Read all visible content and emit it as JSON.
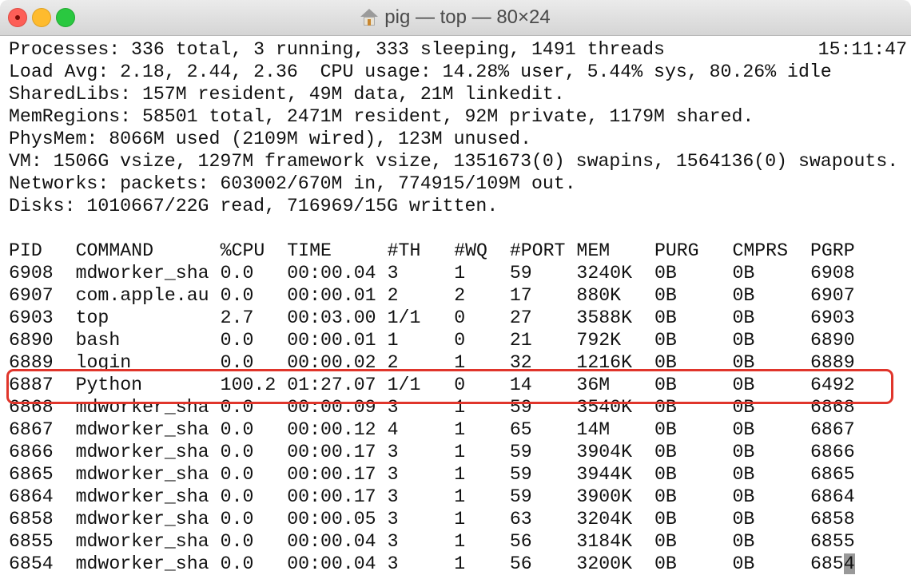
{
  "window": {
    "title": "pig — top — 80×24",
    "title_icon": "home-icon"
  },
  "summary": {
    "lines": [
      "Processes: 336 total, 3 running, 333 sleeping, 1491 threads",
      "Load Avg: 2.18, 2.44, 2.36  CPU usage: 14.28% user, 5.44% sys, 80.26% idle",
      "SharedLibs: 157M resident, 49M data, 21M linkedit.",
      "MemRegions: 58501 total, 2471M resident, 92M private, 1179M shared.",
      "PhysMem: 8066M used (2109M wired), 123M unused.",
      "VM: 1506G vsize, 1297M framework vsize, 1351673(0) swapins, 1564136(0) swapouts.",
      "Networks: packets: 603002/670M in, 774915/109M out.",
      "Disks: 1010667/22G read, 716969/15G written."
    ],
    "clock": "15:11:47"
  },
  "table": {
    "headers": [
      "PID",
      "COMMAND",
      "%CPU",
      "TIME",
      "#TH",
      "#WQ",
      "#PORT",
      "MEM",
      "PURG",
      "CMPRS",
      "PGRP"
    ],
    "rows": [
      [
        "6908",
        "mdworker_sha",
        "0.0",
        "00:00.04",
        "3",
        "1",
        "59",
        "3240K",
        "0B",
        "0B",
        "6908"
      ],
      [
        "6907",
        "com.apple.au",
        "0.0",
        "00:00.01",
        "2",
        "2",
        "17",
        "880K",
        "0B",
        "0B",
        "6907"
      ],
      [
        "6903",
        "top",
        "2.7",
        "00:03.00",
        "1/1",
        "0",
        "27",
        "3588K",
        "0B",
        "0B",
        "6903"
      ],
      [
        "6890",
        "bash",
        "0.0",
        "00:00.01",
        "1",
        "0",
        "21",
        "792K",
        "0B",
        "0B",
        "6890"
      ],
      [
        "6889",
        "login",
        "0.0",
        "00:00.02",
        "2",
        "1",
        "32",
        "1216K",
        "0B",
        "0B",
        "6889"
      ],
      [
        "6887",
        "Python",
        "100.2",
        "01:27.07",
        "1/1",
        "0",
        "14",
        "36M",
        "0B",
        "0B",
        "6492"
      ],
      [
        "6868",
        "mdworker_sha",
        "0.0",
        "00:00.09",
        "3",
        "1",
        "59",
        "3540K",
        "0B",
        "0B",
        "6868"
      ],
      [
        "6867",
        "mdworker_sha",
        "0.0",
        "00:00.12",
        "4",
        "1",
        "65",
        "14M",
        "0B",
        "0B",
        "6867"
      ],
      [
        "6866",
        "mdworker_sha",
        "0.0",
        "00:00.17",
        "3",
        "1",
        "59",
        "3904K",
        "0B",
        "0B",
        "6866"
      ],
      [
        "6865",
        "mdworker_sha",
        "0.0",
        "00:00.17",
        "3",
        "1",
        "59",
        "3944K",
        "0B",
        "0B",
        "6865"
      ],
      [
        "6864",
        "mdworker_sha",
        "0.0",
        "00:00.17",
        "3",
        "1",
        "59",
        "3900K",
        "0B",
        "0B",
        "6864"
      ],
      [
        "6858",
        "mdworker_sha",
        "0.0",
        "00:00.05",
        "3",
        "1",
        "63",
        "3204K",
        "0B",
        "0B",
        "6858"
      ],
      [
        "6855",
        "mdworker_sha",
        "0.0",
        "00:00.04",
        "3",
        "1",
        "56",
        "3184K",
        "0B",
        "0B",
        "6855"
      ],
      [
        "6854",
        "mdworker_sha",
        "0.0",
        "00:00.04",
        "3",
        "1",
        "56",
        "3200K",
        "0B",
        "0B",
        "6854"
      ]
    ],
    "highlighted_row_pid": "6887",
    "highlight_color": "#e0352b"
  }
}
